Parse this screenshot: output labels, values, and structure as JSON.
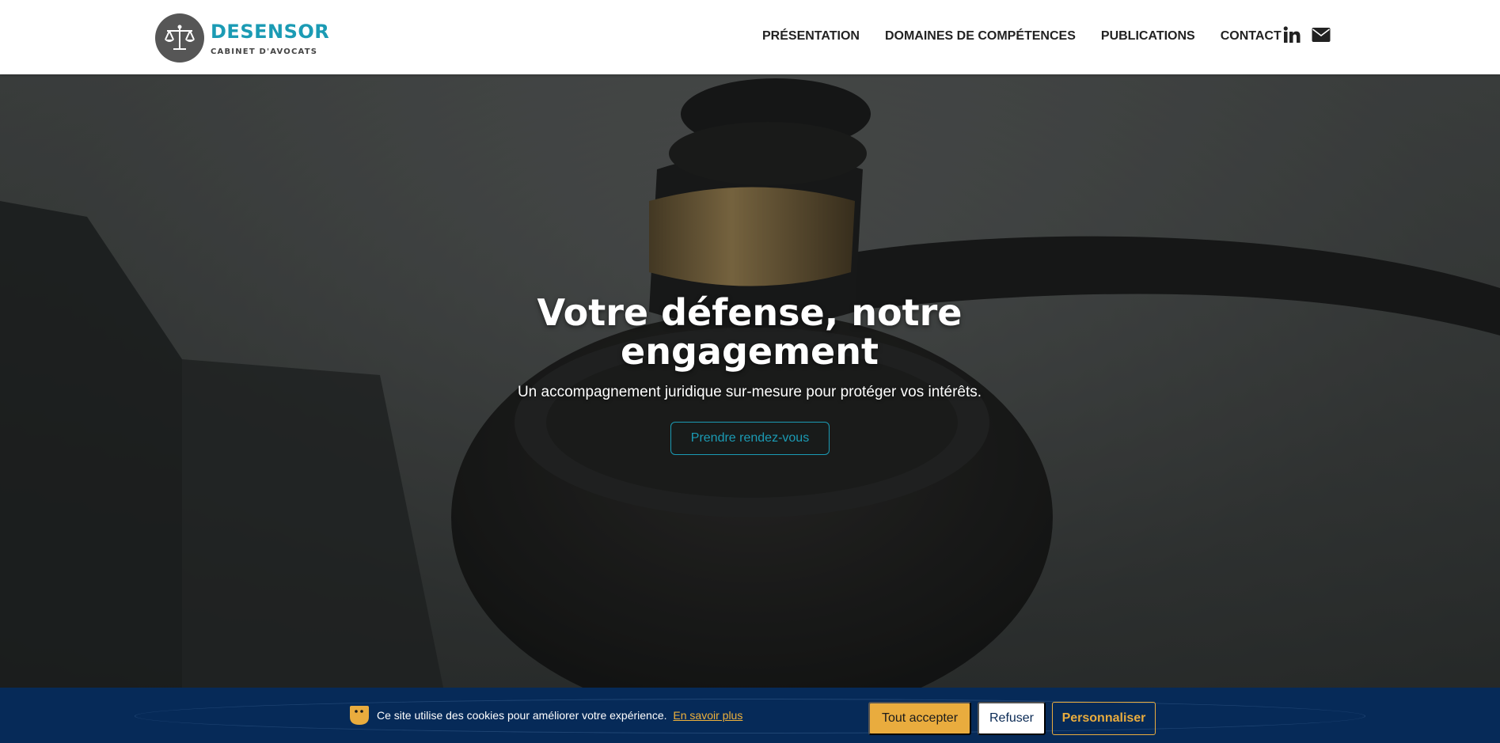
{
  "header": {
    "logo": {
      "name": "DESENSOR",
      "tagline": "CABINET D'AVOCATS",
      "icon": "scales-of-justice-icon"
    },
    "nav": [
      {
        "label": "PRÉSENTATION"
      },
      {
        "label": "DOMAINES DE COMPÉTENCES"
      },
      {
        "label": "PUBLICATIONS"
      },
      {
        "label": "CONTACT"
      }
    ],
    "icons": [
      "linkedin-icon",
      "envelope-icon"
    ]
  },
  "hero": {
    "title": "Votre défense, notre engagement",
    "subtitle": "Un accompagnement juridique sur-mesure pour protéger vos intérêts.",
    "cta_label": "Prendre rendez-vous"
  },
  "cookie_banner": {
    "icon": "cookie-icon",
    "message": "Ce site utilise des cookies pour améliorer votre expérience.",
    "link_label": "En savoir plus",
    "accept_label": "Tout accepter",
    "refuse_label": "Refuser",
    "customize_label": "Personnaliser"
  },
  "colors": {
    "brand": "#1b9bb4",
    "cookie_bg": "#062a58",
    "accent": "#e9ac3e"
  }
}
